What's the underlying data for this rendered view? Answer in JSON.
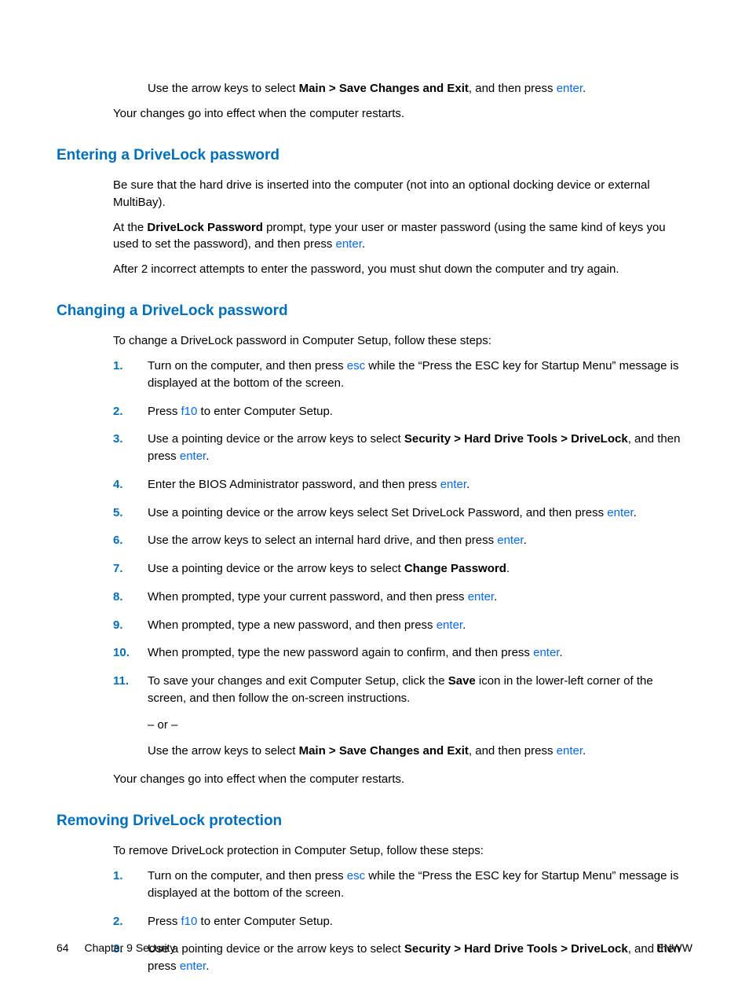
{
  "top": {
    "arrow_text_a": "Use the arrow keys to select ",
    "arrow_text_bold": "Main > Save Changes and Exit",
    "arrow_text_b": ", and then press ",
    "enter": "enter",
    "dot": ".",
    "effect": "Your changes go into effect when the computer restarts."
  },
  "entering": {
    "heading": "Entering a DriveLock password",
    "p1": "Be sure that the hard drive is inserted into the computer (not into an optional docking device or external MultiBay).",
    "p2a": "At the ",
    "p2bold": "DriveLock Password",
    "p2b": " prompt, type your user or master password (using the same kind of keys you used to set the password), and then press ",
    "enter": "enter",
    "dot": ".",
    "p3": "After 2 incorrect attempts to enter the password, you must shut down the computer and try again."
  },
  "changing": {
    "heading": "Changing a DriveLock password",
    "intro": "To change a DriveLock password in Computer Setup, follow these steps:",
    "s1a": "Turn on the computer, and then press ",
    "s1esc": "esc",
    "s1b": " while the “Press the ESC key for Startup Menu” message is displayed at the bottom of the screen.",
    "s2a": "Press ",
    "s2f10": "f10",
    "s2b": " to enter Computer Setup.",
    "s3a": "Use a pointing device or the arrow keys to select ",
    "s3bold": "Security > Hard Drive Tools > DriveLock",
    "s3b": ", and then press ",
    "enter": "enter",
    "dot": ".",
    "s4a": "Enter the BIOS Administrator password, and then press ",
    "s5a": "Use a pointing device or the arrow keys select Set DriveLock Password, and then press ",
    "s6a": "Use the arrow keys to select an internal hard drive, and then press ",
    "s7a": "Use a pointing device or the arrow keys to select ",
    "s7bold": "Change Password",
    "s8a": "When prompted, type your current password, and then press ",
    "s9a": "When prompted, type a new password, and then press ",
    "s10a": "When prompted, type the new password again to confirm, and then press ",
    "s11a": "To save your changes and exit Computer Setup, click the ",
    "s11bold": "Save",
    "s11b": " icon in the lower-left corner of the screen, and then follow the on-screen instructions.",
    "or": "– or –",
    "s11c": "Use the arrow keys to select ",
    "s11bold2": "Main > Save Changes and Exit",
    "s11d": ", and then press ",
    "effect": "Your changes go into effect when the computer restarts."
  },
  "removing": {
    "heading": "Removing DriveLock protection",
    "intro": "To remove DriveLock protection in Computer Setup, follow these steps:",
    "s1a": "Turn on the computer, and then press ",
    "s1esc": "esc",
    "s1b": " while the “Press the ESC key for Startup Menu” message is displayed at the bottom of the screen.",
    "s2a": "Press ",
    "s2f10": "f10",
    "s2b": " to enter Computer Setup.",
    "s3a": "Use a pointing device or the arrow keys to select ",
    "s3bold": "Security > Hard Drive Tools > DriveLock",
    "s3b": ", and then press ",
    "enter": "enter",
    "dot": "."
  },
  "footer": {
    "page": "64",
    "chapter": "Chapter 9   Security",
    "right": "ENWW"
  }
}
